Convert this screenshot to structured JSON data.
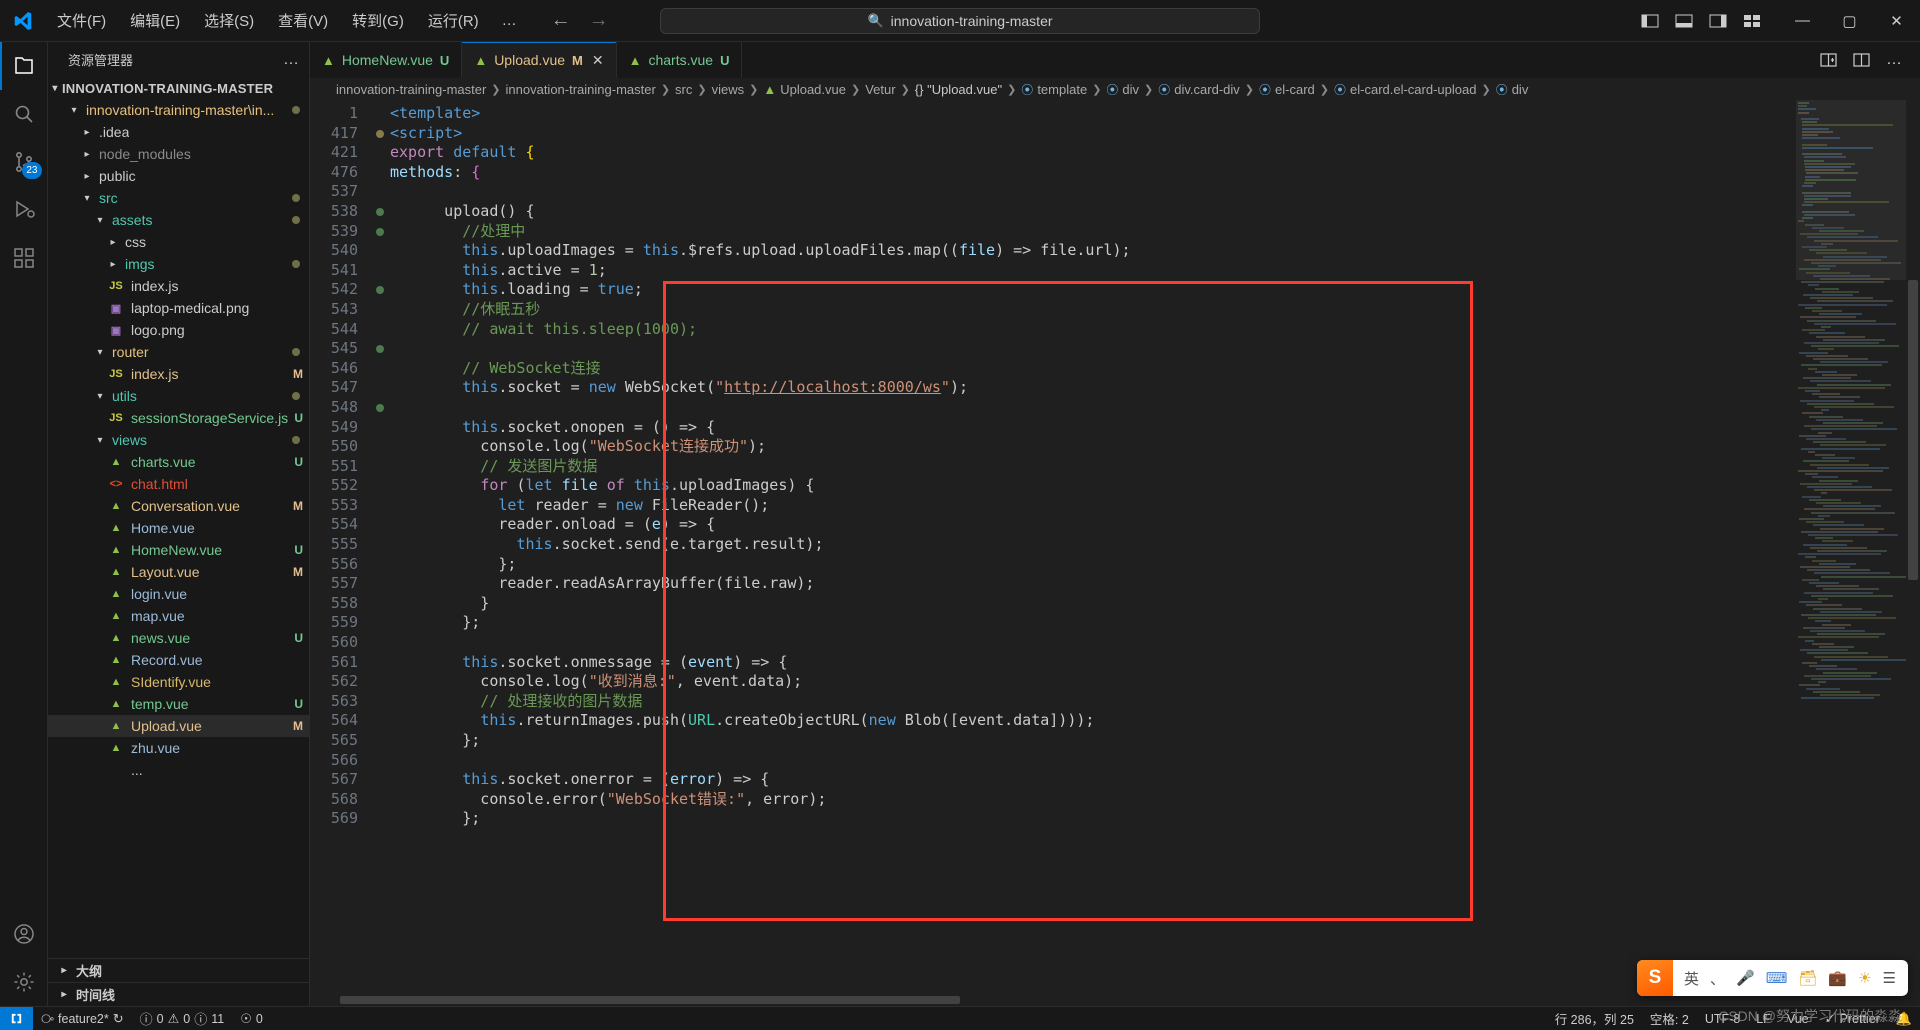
{
  "titlebar": {
    "menus": [
      "文件(F)",
      "编辑(E)",
      "选择(S)",
      "查看(V)",
      "转到(G)",
      "运行(R)"
    ],
    "more": "…",
    "back_arrow": "←",
    "forward_arrow": "→",
    "search_placeholder": "innovation-training-master",
    "search_icon": "search-icon",
    "window_minimize": "—",
    "window_maximize": "▢",
    "window_close": "✕"
  },
  "activitybar": {
    "items": [
      {
        "name": "explorer",
        "badge": null
      },
      {
        "name": "search",
        "badge": null
      },
      {
        "name": "source-control",
        "badge": "23"
      },
      {
        "name": "run-and-debug",
        "badge": null
      },
      {
        "name": "extensions",
        "badge": null
      }
    ],
    "bottom": [
      {
        "name": "accounts"
      },
      {
        "name": "settings"
      }
    ]
  },
  "sidebar": {
    "title": "资源管理器",
    "more_actions": "…",
    "root": "INNOVATION-TRAINING-MASTER",
    "tree": [
      {
        "label": "innovation-training-master\\in...",
        "depth": 1,
        "type": "folder",
        "expanded": true,
        "color": "#e8c07d",
        "dot": "#6f6f4a"
      },
      {
        "label": ".idea",
        "depth": 2,
        "type": "folder",
        "expanded": false,
        "color": "#cccccc"
      },
      {
        "label": "node_modules",
        "depth": 2,
        "type": "folder",
        "expanded": false,
        "color": "#8a8a8a"
      },
      {
        "label": "public",
        "depth": 2,
        "type": "folder",
        "expanded": false,
        "color": "#cccccc"
      },
      {
        "label": "src",
        "depth": 2,
        "type": "folder",
        "expanded": true,
        "color": "#4ec9b0",
        "dot": "#6f6f4a"
      },
      {
        "label": "assets",
        "depth": 3,
        "type": "folder",
        "expanded": true,
        "color": "#4ec9b0",
        "dot": "#6f6f4a"
      },
      {
        "label": "css",
        "depth": 4,
        "type": "folder",
        "expanded": false,
        "color": "#cccccc"
      },
      {
        "label": "imgs",
        "depth": 4,
        "type": "folder",
        "expanded": false,
        "color": "#4ec9b0",
        "dot": "#6f6f4a"
      },
      {
        "label": "index.js",
        "depth": 4,
        "type": "js",
        "color": "#cccccc"
      },
      {
        "label": "laptop-medical.png",
        "depth": 4,
        "type": "img",
        "color": "#cccccc"
      },
      {
        "label": "logo.png",
        "depth": 4,
        "type": "img",
        "color": "#cccccc"
      },
      {
        "label": "router",
        "depth": 3,
        "type": "folder",
        "expanded": true,
        "color": "#e8c07d",
        "dot": "#6f6f4a"
      },
      {
        "label": "index.js",
        "depth": 4,
        "type": "js",
        "color": "#e2c08d",
        "status": "M",
        "status_color": "#e2c08d"
      },
      {
        "label": "utils",
        "depth": 3,
        "type": "folder",
        "expanded": true,
        "color": "#4ec9b0",
        "dot": "#6f6f4a"
      },
      {
        "label": "sessionStorageService.js",
        "depth": 4,
        "type": "js",
        "color": "#73c991",
        "status": "U",
        "status_color": "#73c991"
      },
      {
        "label": "views",
        "depth": 3,
        "type": "folder",
        "expanded": true,
        "color": "#4ec9b0",
        "dot": "#6f6f4a"
      },
      {
        "label": "charts.vue",
        "depth": 4,
        "type": "vue",
        "color": "#73c991",
        "status": "U",
        "status_color": "#73c991"
      },
      {
        "label": "chat.html",
        "depth": 4,
        "type": "html",
        "color": "#e04e39"
      },
      {
        "label": "Conversation.vue",
        "depth": 4,
        "type": "vue",
        "color": "#e2c08d",
        "status": "M",
        "status_color": "#e2c08d"
      },
      {
        "label": "Home.vue",
        "depth": 4,
        "type": "vue",
        "color": "#9cbbd8"
      },
      {
        "label": "HomeNew.vue",
        "depth": 4,
        "type": "vue",
        "color": "#73c991",
        "status": "U",
        "status_color": "#73c991"
      },
      {
        "label": "Layout.vue",
        "depth": 4,
        "type": "vue",
        "color": "#e2c08d",
        "status": "M",
        "status_color": "#e2c08d"
      },
      {
        "label": "login.vue",
        "depth": 4,
        "type": "vue",
        "color": "#9cbbd8"
      },
      {
        "label": "map.vue",
        "depth": 4,
        "type": "vue",
        "color": "#9cbbd8"
      },
      {
        "label": "news.vue",
        "depth": 4,
        "type": "vue",
        "color": "#73c991",
        "status": "U",
        "status_color": "#73c991"
      },
      {
        "label": "Record.vue",
        "depth": 4,
        "type": "vue",
        "color": "#9cbbd8"
      },
      {
        "label": "SIdentify.vue",
        "depth": 4,
        "type": "vue",
        "color": "#d8b86a"
      },
      {
        "label": "temp.vue",
        "depth": 4,
        "type": "vue",
        "color": "#73c991",
        "status": "U",
        "status_color": "#73c991"
      },
      {
        "label": "Upload.vue",
        "depth": 4,
        "type": "vue",
        "color": "#e2c08d",
        "status": "M",
        "status_color": "#e2c08d",
        "selected": true
      },
      {
        "label": "zhu.vue",
        "depth": 4,
        "type": "vue",
        "color": "#9cbbd8"
      },
      {
        "label": "...",
        "depth": 4,
        "type": "none",
        "color": "#cccccc"
      }
    ],
    "sections": [
      {
        "label": "大纲"
      },
      {
        "label": "时间线"
      }
    ]
  },
  "tabs": [
    {
      "label": "HomeNew.vue",
      "status": "U",
      "status_class": "u",
      "active": false,
      "icon": "vue-icon"
    },
    {
      "label": "Upload.vue",
      "status": "M",
      "status_class": "m",
      "active": true,
      "icon": "vue-icon",
      "close": "✕"
    },
    {
      "label": "charts.vue",
      "status": "U",
      "status_class": "u",
      "active": false,
      "icon": "vue-icon"
    }
  ],
  "tabs_actions": {
    "split_editor": "split-editor-icon",
    "layout": "editor-layout-icon",
    "more": "…"
  },
  "breadcrumbs": [
    {
      "label": "innovation-training-master",
      "kind": "plain"
    },
    {
      "label": "innovation-training-master",
      "kind": "plain"
    },
    {
      "label": "src",
      "kind": "plain"
    },
    {
      "label": "views",
      "kind": "plain"
    },
    {
      "label": "Upload.vue",
      "kind": "vue"
    },
    {
      "label": "Vetur",
      "kind": "plain"
    },
    {
      "label": "{} \"Upload.vue\"",
      "kind": "sym-brace"
    },
    {
      "label": "template",
      "kind": "cube"
    },
    {
      "label": "div",
      "kind": "cube"
    },
    {
      "label": "div.card-div",
      "kind": "cube"
    },
    {
      "label": "el-card",
      "kind": "cube"
    },
    {
      "label": "el-card.el-card-upload",
      "kind": "cube"
    },
    {
      "label": "div",
      "kind": "cube"
    }
  ],
  "code": {
    "header_lines": [
      {
        "num": "1",
        "indent": 0,
        "tokens": [
          {
            "t": "<template>",
            "c": "tok-tag"
          }
        ]
      },
      {
        "num": "417",
        "indent": 0,
        "tokens": [
          {
            "t": "<script>",
            "c": "tok-tag"
          }
        ]
      },
      {
        "num": "421",
        "indent": 0,
        "tokens": [
          {
            "t": "export ",
            "c": "tok-kw"
          },
          {
            "t": "default ",
            "c": "tok-kw2"
          },
          {
            "t": "{",
            "c": "tok-brkt-y"
          }
        ]
      },
      {
        "num": "476",
        "indent": 1,
        "tokens": [
          {
            "t": "methods",
            "c": "tok-var"
          },
          {
            "t": ": ",
            "c": "tok-plain"
          },
          {
            "t": "{",
            "c": "tok-brkt-p"
          }
        ]
      }
    ],
    "lines": [
      {
        "num": "537",
        "tokens": []
      },
      {
        "num": "538",
        "tokens": [
          {
            "t": "      upload() {",
            "c": "tok-plain"
          }
        ]
      },
      {
        "num": "539",
        "tokens": [
          {
            "t": "        //处理中",
            "c": "tok-cmt"
          }
        ]
      },
      {
        "num": "540",
        "tokens": [
          {
            "t": "        ",
            "c": "tok-plain"
          },
          {
            "t": "this",
            "c": "tok-kw2"
          },
          {
            "t": ".uploadImages = ",
            "c": "tok-plain"
          },
          {
            "t": "this",
            "c": "tok-kw2"
          },
          {
            "t": ".$refs.upload.uploadFiles.map((",
            "c": "tok-plain"
          },
          {
            "t": "file",
            "c": "tok-var"
          },
          {
            "t": ") => file.url);",
            "c": "tok-plain"
          }
        ]
      },
      {
        "num": "541",
        "tokens": [
          {
            "t": "        ",
            "c": "tok-plain"
          },
          {
            "t": "this",
            "c": "tok-kw2"
          },
          {
            "t": ".active = ",
            "c": "tok-plain"
          },
          {
            "t": "1",
            "c": "tok-num"
          },
          {
            "t": ";",
            "c": "tok-plain"
          }
        ]
      },
      {
        "num": "542",
        "tokens": [
          {
            "t": "        ",
            "c": "tok-plain"
          },
          {
            "t": "this",
            "c": "tok-kw2"
          },
          {
            "t": ".loading = ",
            "c": "tok-plain"
          },
          {
            "t": "true",
            "c": "tok-kw2"
          },
          {
            "t": ";",
            "c": "tok-plain"
          }
        ]
      },
      {
        "num": "543",
        "tokens": [
          {
            "t": "        //休眠五秒",
            "c": "tok-cmt"
          }
        ]
      },
      {
        "num": "544",
        "tokens": [
          {
            "t": "        // await this.sleep(1000);",
            "c": "tok-cmt"
          }
        ]
      },
      {
        "num": "545",
        "tokens": []
      },
      {
        "num": "546",
        "tokens": [
          {
            "t": "        // WebSocket连接",
            "c": "tok-cmt"
          }
        ]
      },
      {
        "num": "547",
        "tokens": [
          {
            "t": "        ",
            "c": "tok-plain"
          },
          {
            "t": "this",
            "c": "tok-kw2"
          },
          {
            "t": ".socket = ",
            "c": "tok-plain"
          },
          {
            "t": "new ",
            "c": "tok-kw2"
          },
          {
            "t": "WebSocket(",
            "c": "tok-plain"
          },
          {
            "t": "\"",
            "c": "tok-str"
          },
          {
            "t": "http://localhost:8000/ws",
            "c": "tok-link"
          },
          {
            "t": "\"",
            "c": "tok-str"
          },
          {
            "t": ");",
            "c": "tok-plain"
          }
        ]
      },
      {
        "num": "548",
        "tokens": []
      },
      {
        "num": "549",
        "tokens": [
          {
            "t": "        ",
            "c": "tok-plain"
          },
          {
            "t": "this",
            "c": "tok-kw2"
          },
          {
            "t": ".socket.onopen = () => {",
            "c": "tok-plain"
          }
        ]
      },
      {
        "num": "550",
        "tokens": [
          {
            "t": "          console.log(",
            "c": "tok-plain"
          },
          {
            "t": "\"WebSocket连接成功\"",
            "c": "tok-str"
          },
          {
            "t": ");",
            "c": "tok-plain"
          }
        ]
      },
      {
        "num": "551",
        "tokens": [
          {
            "t": "          // 发送图片数据",
            "c": "tok-cmt"
          }
        ]
      },
      {
        "num": "552",
        "tokens": [
          {
            "t": "          ",
            "c": "tok-plain"
          },
          {
            "t": "for ",
            "c": "tok-kw"
          },
          {
            "t": "(",
            "c": "tok-plain"
          },
          {
            "t": "let ",
            "c": "tok-kw2"
          },
          {
            "t": "file ",
            "c": "tok-var"
          },
          {
            "t": "of ",
            "c": "tok-kw"
          },
          {
            "t": "this",
            "c": "tok-kw2"
          },
          {
            "t": ".uploadImages) {",
            "c": "tok-plain"
          }
        ]
      },
      {
        "num": "553",
        "tokens": [
          {
            "t": "            ",
            "c": "tok-plain"
          },
          {
            "t": "let ",
            "c": "tok-kw2"
          },
          {
            "t": "reader = ",
            "c": "tok-plain"
          },
          {
            "t": "new ",
            "c": "tok-kw2"
          },
          {
            "t": "FileReader();",
            "c": "tok-plain"
          }
        ]
      },
      {
        "num": "554",
        "tokens": [
          {
            "t": "            reader.onload = (",
            "c": "tok-plain"
          },
          {
            "t": "e",
            "c": "tok-var"
          },
          {
            "t": ") => {",
            "c": "tok-plain"
          }
        ]
      },
      {
        "num": "555",
        "tokens": [
          {
            "t": "              ",
            "c": "tok-plain"
          },
          {
            "t": "this",
            "c": "tok-kw2"
          },
          {
            "t": ".socket.send(e.target.result);",
            "c": "tok-plain"
          }
        ]
      },
      {
        "num": "556",
        "tokens": [
          {
            "t": "            };",
            "c": "tok-plain"
          }
        ]
      },
      {
        "num": "557",
        "tokens": [
          {
            "t": "            reader.readAsArrayBuffer(file.raw);",
            "c": "tok-plain"
          }
        ]
      },
      {
        "num": "558",
        "tokens": [
          {
            "t": "          }",
            "c": "tok-plain"
          }
        ]
      },
      {
        "num": "559",
        "tokens": [
          {
            "t": "        };",
            "c": "tok-plain"
          }
        ]
      },
      {
        "num": "560",
        "tokens": []
      },
      {
        "num": "561",
        "tokens": [
          {
            "t": "        ",
            "c": "tok-plain"
          },
          {
            "t": "this",
            "c": "tok-kw2"
          },
          {
            "t": ".socket.onmessage = (",
            "c": "tok-plain"
          },
          {
            "t": "event",
            "c": "tok-var"
          },
          {
            "t": ") => {",
            "c": "tok-plain"
          }
        ]
      },
      {
        "num": "562",
        "tokens": [
          {
            "t": "          console.log(",
            "c": "tok-plain"
          },
          {
            "t": "\"收到消息:\"",
            "c": "tok-str"
          },
          {
            "t": ", event.data);",
            "c": "tok-plain"
          }
        ]
      },
      {
        "num": "563",
        "tokens": [
          {
            "t": "          // 处理接收的图片数据",
            "c": "tok-cmt"
          }
        ]
      },
      {
        "num": "564",
        "tokens": [
          {
            "t": "          ",
            "c": "tok-plain"
          },
          {
            "t": "this",
            "c": "tok-kw2"
          },
          {
            "t": ".returnImages.push(",
            "c": "tok-plain"
          },
          {
            "t": "URL",
            "c": "tok-cls"
          },
          {
            "t": ".createObjectURL(",
            "c": "tok-plain"
          },
          {
            "t": "new ",
            "c": "tok-kw2"
          },
          {
            "t": "Blob([event.data])));",
            "c": "tok-plain"
          }
        ]
      },
      {
        "num": "565",
        "tokens": [
          {
            "t": "        };",
            "c": "tok-plain"
          }
        ]
      },
      {
        "num": "566",
        "tokens": []
      },
      {
        "num": "567",
        "tokens": [
          {
            "t": "        ",
            "c": "tok-plain"
          },
          {
            "t": "this",
            "c": "tok-kw2"
          },
          {
            "t": ".socket.onerror = (",
            "c": "tok-plain"
          },
          {
            "t": "error",
            "c": "tok-var"
          },
          {
            "t": ") => {",
            "c": "tok-plain"
          }
        ]
      },
      {
        "num": "568",
        "tokens": [
          {
            "t": "          console.error(",
            "c": "tok-plain"
          },
          {
            "t": "\"WebSocket错误:\"",
            "c": "tok-str"
          },
          {
            "t": ", error);",
            "c": "tok-plain"
          }
        ]
      },
      {
        "num": "569",
        "tokens": [
          {
            "t": "        };",
            "c": "tok-plain"
          }
        ]
      }
    ]
  },
  "statusbar": {
    "remote_icon": "remote-window-icon",
    "branch": "feature2*",
    "branch_icon": "source-control-icon",
    "sync_icon": "sync-icon",
    "errors": "0",
    "warnings": "0",
    "infos": "11",
    "ports": "0",
    "ports_icon": "radio-tower-icon",
    "cursor": "行 286，列 25",
    "spaces": "空格: 2",
    "encoding": "UTF-8",
    "eol": "LF",
    "language": "Vue",
    "bell_icon": "bell-icon",
    "prettier": "Prettier"
  },
  "ime": {
    "logo": "S",
    "mode": "英",
    "items": [
      "comma-icon",
      "mic-icon",
      "keyboard-icon",
      "toolbox-icon",
      "bag-icon",
      "sun-icon",
      "menu-icon"
    ]
  },
  "watermark": "CSDN @努力学习代码的淼淼"
}
